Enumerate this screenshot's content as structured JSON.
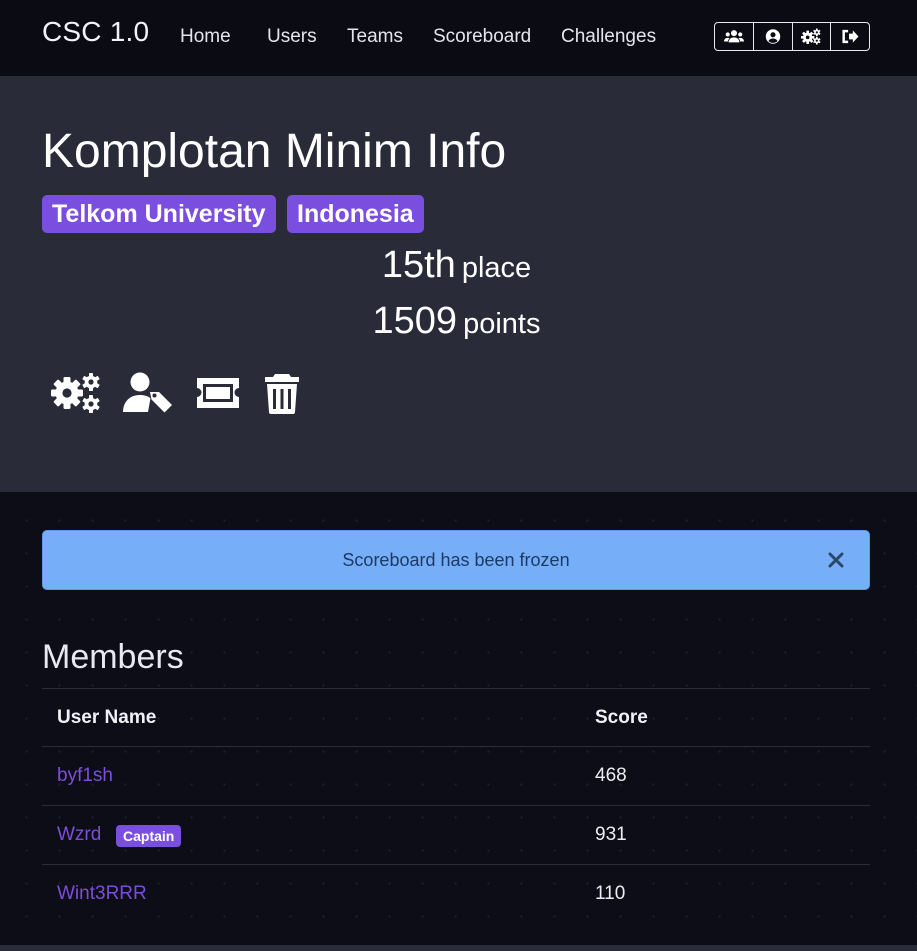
{
  "navbar": {
    "brand": "CSC 1.0",
    "links": [
      "Home",
      "Users",
      "Teams",
      "Scoreboard",
      "Challenges"
    ],
    "icons": [
      "users-icon",
      "user-circle-icon",
      "cogs-icon",
      "sign-out-icon"
    ]
  },
  "team": {
    "name": "Komplotan Minim Info",
    "affiliation": "Telkom University",
    "country": "Indonesia",
    "place_value": "15th",
    "place_label": "place",
    "points_value": "1509",
    "points_label": "points",
    "action_icons": [
      "cogs-icon",
      "user-tag-icon",
      "ticket-icon",
      "trash-icon"
    ]
  },
  "alert": {
    "message": "Scoreboard has been frozen",
    "close_icon": "close-icon"
  },
  "members": {
    "title": "Members",
    "headers": [
      "User Name",
      "Score"
    ],
    "rows": [
      {
        "name": "byf1sh",
        "score": "468",
        "badge": ""
      },
      {
        "name": "Wzrd",
        "score": "931",
        "badge": "Captain"
      },
      {
        "name": "Wint3RRR",
        "score": "110",
        "badge": ""
      }
    ]
  },
  "colors": {
    "accent": "#7a4fe0",
    "alert_bg": "#76aff7",
    "header_bg": "#2a2b39",
    "page_bg": "#0d0d17"
  }
}
